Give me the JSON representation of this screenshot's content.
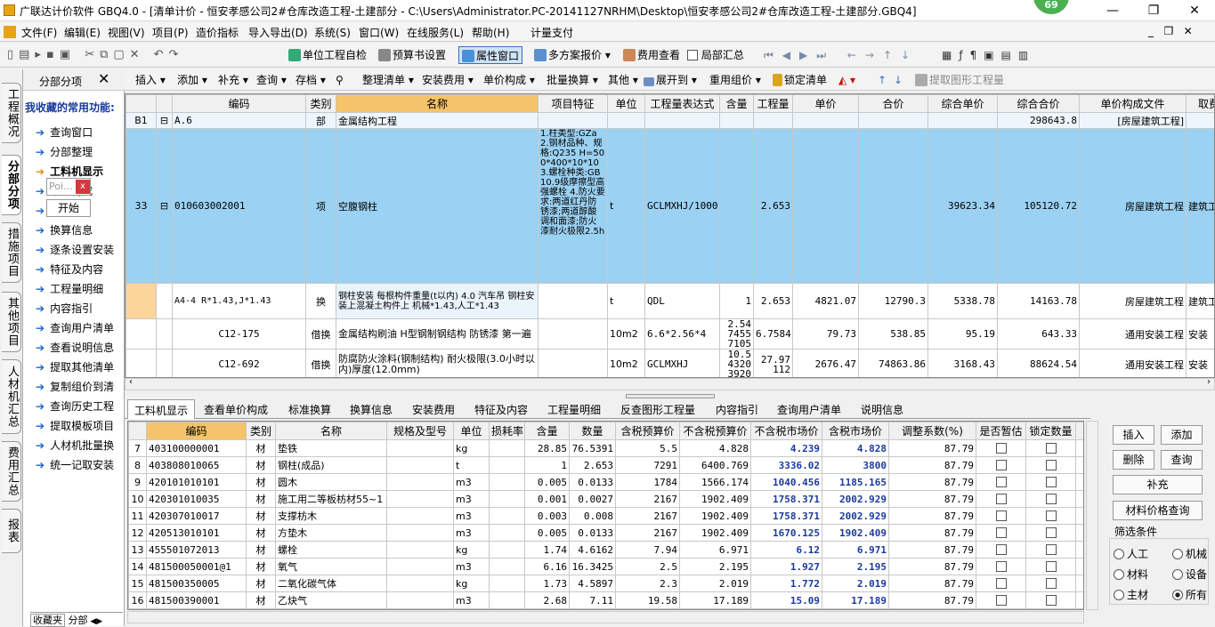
{
  "window": {
    "title": "广联达计价软件 GBQ4.0 - [清单计价 - 恒安孝感公司2#仓库改造工程-土建部分 - C:\\Users\\Administrator.PC-20141127NRHM\\Desktop\\恒安孝感公司2#仓库改造工程-土建部分.GBQ4]",
    "badge": "69",
    "controls": [
      "—",
      "❐",
      "✕"
    ]
  },
  "menu": [
    "文件(F)",
    "编辑(E)",
    "视图(V)",
    "项目(P)",
    "造价指标",
    "导入导出(D)",
    "系统(S)",
    "窗口(W)",
    "在线服务(L)",
    "帮助(H)",
    "计量支付"
  ],
  "toolbar1": {
    "unit_check": "单位工程自检",
    "budget_settings": "预算书设置",
    "property_window": "属性窗口",
    "multi_quote": "多方案报价",
    "fee_view": "费用查看",
    "partial_summary": "局部汇总"
  },
  "toolbar2": [
    "插入",
    "添加",
    "补充",
    "查询",
    "存档",
    "整理清单",
    "安装费用",
    "单价构成",
    "批量换算",
    "其他",
    "展开到",
    "重用组价",
    "锁定清单",
    "提取图形工程量"
  ],
  "left_tabs": [
    "工程概况",
    "分部分项",
    "措施项目",
    "其他项目",
    "人材机汇总",
    "费用汇总",
    "报表"
  ],
  "fav_panel": {
    "header": "分部分项",
    "title": "我收藏的常用功能:",
    "items": [
      "查询窗口",
      "分部整理",
      "工料机显示",
      "单价构成",
      "换算",
      "换算信息",
      "逐条设置安装",
      "特征及内容",
      "工程量明细",
      "内容指引",
      "查询用户清单",
      "查看说明信息",
      "提取其他清单",
      "复制组价到清",
      "查询历史工程",
      "提取模板项目",
      "人材机批量换",
      "统一记取安装"
    ],
    "popup_text": "Poi...",
    "popup_close": "x",
    "start_button": "开始",
    "bottom_tabs": [
      "收藏夹",
      "分部"
    ]
  },
  "top_grid": {
    "headers": [
      "编码",
      "类别",
      "名称",
      "项目特征",
      "单位",
      "工程量表达式",
      "含量",
      "工程量",
      "单价",
      "合价",
      "综合单价",
      "综合合价",
      "单价构成文件",
      "取费专业"
    ],
    "rows": [
      {
        "no": "B1",
        "code": "A.6",
        "type": "部",
        "name": "金属结构工程",
        "feature": "",
        "unit": "",
        "expr": "",
        "content": "",
        "qty": "",
        "price": "",
        "total": "",
        "comp_price": "",
        "comp_total": "298643.8",
        "file": "[房屋建筑工程]",
        "spec": ""
      },
      {
        "no": "33",
        "code": "010603002001",
        "type": "项",
        "name": "空腹钢柱",
        "feature": "1.柱类型:GZa 2.钢材品种、规格:Q235 H=500*400*10*10 3.螺栓种类:GB10.9级摩擦型高强螺栓 4.防火要求:两道红丹防锈漆;两道醇酸调和面漆;防火漆耐火极限2.5h",
        "unit": "t",
        "expr": "GCLMXHJ/1000",
        "content": "",
        "qty": "2.653",
        "price": "",
        "total": "",
        "comp_price": "39623.34",
        "comp_total": "105120.72",
        "file": "房屋建筑工程",
        "spec": "建筑工程"
      },
      {
        "no": "",
        "code": "A4-4 R*1.43,J*1.43",
        "type": "换",
        "name": "钢柱安装 每根构件重量(t以内) 4.0 汽车吊 钢柱安装上混凝土构件上 机械*1.43,人工*1.43",
        "feature": "",
        "unit": "t",
        "expr": "QDL",
        "content": "1",
        "qty": "2.653",
        "price": "4821.07",
        "total": "12790.3",
        "comp_price": "5338.78",
        "comp_total": "14163.78",
        "file": "房屋建筑工程",
        "spec": "建筑工程"
      },
      {
        "no": "",
        "code": "C12-175",
        "type": "借换",
        "name": "金属结构刷油 H型钢制钢结构 防锈漆 第一遍",
        "feature": "",
        "unit": "10m2",
        "expr": "6.6*2.56*4",
        "content": "2.5474557105",
        "qty": "6.7584",
        "price": "79.73",
        "total": "538.85",
        "comp_price": "95.19",
        "comp_total": "643.33",
        "file": "通用安装工程",
        "spec": "安装"
      },
      {
        "no": "",
        "code": "C12-692",
        "type": "借换",
        "name": "防腐防火涂料(钢制结构) 耐火极限(3.0小时以内)厚度(12.0mm)",
        "feature": "",
        "unit": "10m2",
        "expr": "GCLMXHJ",
        "content": "10.543203920",
        "qty": "27.97112",
        "price": "2676.47",
        "total": "74863.86",
        "comp_price": "3168.43",
        "comp_total": "88624.54",
        "file": "通用安装工程",
        "spec": "安装"
      }
    ]
  },
  "bottom_tabs": [
    "工料机显示",
    "查看单价构成",
    "标准换算",
    "换算信息",
    "安装费用",
    "特征及内容",
    "工程量明细",
    "反查图形工程量",
    "内容指引",
    "查询用户清单",
    "说明信息"
  ],
  "bottom_grid": {
    "headers": [
      "编码",
      "类别",
      "名称",
      "规格及型号",
      "单位",
      "损耗率",
      "含量",
      "数量",
      "含税预算价",
      "不含税预算价",
      "不含税市场价",
      "含税市场价",
      "调整系数(%)",
      "是否暂估",
      "锁定数量"
    ],
    "rows": [
      {
        "no": "7",
        "code": "403100000001",
        "type": "材",
        "name": "垫铁",
        "model": "",
        "unit": "kg",
        "loss": "",
        "content": "28.85",
        "qty": "76.5391",
        "tax_budget": "5.5",
        "notax_budget": "4.828",
        "notax_market": "4.239",
        "tax_market": "4.828",
        "coef": "87.79"
      },
      {
        "no": "8",
        "code": "403808010065",
        "type": "材",
        "name": "钢柱(成品)",
        "model": "",
        "unit": "t",
        "loss": "",
        "content": "1",
        "qty": "2.653",
        "tax_budget": "7291",
        "notax_budget": "6400.769",
        "notax_market": "3336.02",
        "tax_market": "3800",
        "coef": "87.79"
      },
      {
        "no": "9",
        "code": "420101010101",
        "type": "材",
        "name": "圆木",
        "model": "",
        "unit": "m3",
        "loss": "",
        "content": "0.005",
        "qty": "0.0133",
        "tax_budget": "1784",
        "notax_budget": "1566.174",
        "notax_market": "1040.456",
        "tax_market": "1185.165",
        "coef": "87.79"
      },
      {
        "no": "10",
        "code": "420301010035",
        "type": "材",
        "name": "施工用二等板枋材55~1",
        "model": "",
        "unit": "m3",
        "loss": "",
        "content": "0.001",
        "qty": "0.0027",
        "tax_budget": "2167",
        "notax_budget": "1902.409",
        "notax_market": "1758.371",
        "tax_market": "2002.929",
        "coef": "87.79"
      },
      {
        "no": "11",
        "code": "420307010017",
        "type": "材",
        "name": "支撑枋木",
        "model": "",
        "unit": "m3",
        "loss": "",
        "content": "0.003",
        "qty": "0.008",
        "tax_budget": "2167",
        "notax_budget": "1902.409",
        "notax_market": "1758.371",
        "tax_market": "2002.929",
        "coef": "87.79"
      },
      {
        "no": "12",
        "code": "420513010101",
        "type": "材",
        "name": "方垫木",
        "model": "",
        "unit": "m3",
        "loss": "",
        "content": "0.005",
        "qty": "0.0133",
        "tax_budget": "2167",
        "notax_budget": "1902.409",
        "notax_market": "1670.125",
        "tax_market": "1902.409",
        "coef": "87.79"
      },
      {
        "no": "13",
        "code": "455501072013",
        "type": "材",
        "name": "螺栓",
        "model": "",
        "unit": "kg",
        "loss": "",
        "content": "1.74",
        "qty": "4.6162",
        "tax_budget": "7.94",
        "notax_budget": "6.971",
        "notax_market": "6.12",
        "tax_market": "6.971",
        "coef": "87.79"
      },
      {
        "no": "14",
        "code": "481500050001@1",
        "type": "材",
        "name": "氧气",
        "model": "",
        "unit": "m3",
        "loss": "",
        "content": "6.16",
        "qty": "16.3425",
        "tax_budget": "2.5",
        "notax_budget": "2.195",
        "notax_market": "1.927",
        "tax_market": "2.195",
        "coef": "87.79"
      },
      {
        "no": "15",
        "code": "481500350005",
        "type": "材",
        "name": "二氧化碳气体",
        "model": "",
        "unit": "kg",
        "loss": "",
        "content": "1.73",
        "qty": "4.5897",
        "tax_budget": "2.3",
        "notax_budget": "2.019",
        "notax_market": "1.772",
        "tax_market": "2.019",
        "coef": "87.79"
      },
      {
        "no": "16",
        "code": "481500390001",
        "type": "材",
        "name": "乙炔气",
        "model": "",
        "unit": "m3",
        "loss": "",
        "content": "2.68",
        "qty": "7.11",
        "tax_budget": "19.58",
        "notax_budget": "17.189",
        "notax_market": "15.09",
        "tax_market": "17.189",
        "coef": "87.79"
      }
    ]
  },
  "right_panel": {
    "insert": "插入",
    "add": "添加",
    "delete": "删除",
    "query": "查询",
    "supplement": "补充",
    "price_query": "材料价格查询",
    "filter_title": "筛选条件",
    "filters": [
      "人工",
      "机械",
      "材料",
      "设备",
      "主材",
      "所有"
    ],
    "selected_filter": "所有"
  }
}
